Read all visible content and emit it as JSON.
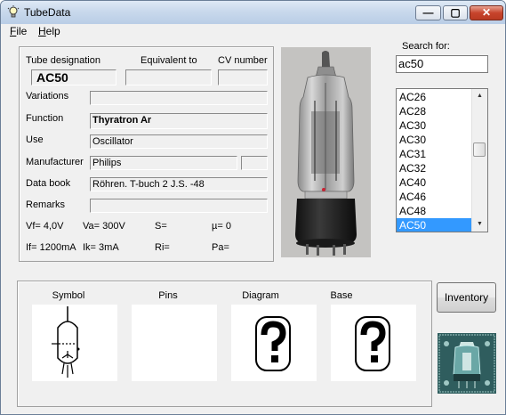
{
  "window": {
    "title": "TubeData",
    "controls": {
      "minimize": "—",
      "maximize": "▢",
      "close": "✕"
    }
  },
  "menu": {
    "file": "File",
    "help": "Help"
  },
  "details": {
    "designation_label": "Tube designation",
    "designation_value": "AC50",
    "equivalent_label": "Equivalent to",
    "equivalent_value": "",
    "cv_label": "CV number",
    "cv_value": "",
    "variations_label": "Variations",
    "variations_value": "",
    "function_label": "Function",
    "function_value": "Thyratron Ar",
    "use_label": "Use",
    "use_value": "Oscillator",
    "manufacturer_label": "Manufacturer",
    "manufacturer_value": "Philips",
    "databook_label": "Data book",
    "databook_value": "Röhren. T-buch 2 J.S. -48",
    "remarks_label": "Remarks",
    "remarks_value": "",
    "params": {
      "vf": "Vf= 4,0V",
      "va": "Va= 300V",
      "s": "S=",
      "mu": "µ=   0",
      "if": "If= 1200mA",
      "ik": "Ik=  3mA",
      "ri": "Ri=",
      "pa": "Pa="
    }
  },
  "search": {
    "label": "Search for:",
    "value": "ac50"
  },
  "list": {
    "items": [
      "AC26",
      "AC28",
      "AC30",
      "AC30",
      "AC31",
      "AC32",
      "AC40",
      "AC46",
      "AC48",
      "AC50"
    ],
    "selected": "AC50"
  },
  "images": {
    "symbol_label": "Symbol",
    "pins_label": "Pins",
    "diagram_label": "Diagram",
    "base_label": "Base"
  },
  "buttons": {
    "inventory": "Inventory"
  },
  "colors": {
    "selection": "#3399ff",
    "titlebar": "#c9d9ec",
    "close": "#c7442c"
  }
}
